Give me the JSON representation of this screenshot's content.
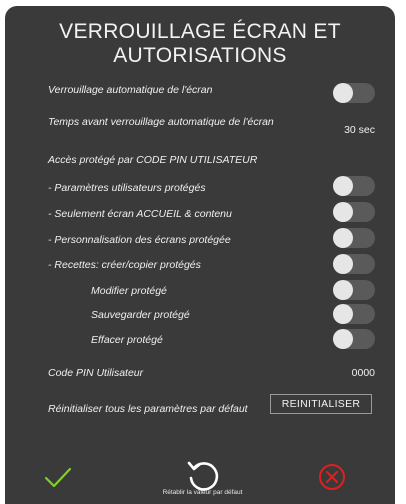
{
  "dialog": {
    "title": "VERROUILLAGE ÉCRAN ET AUTORISATIONS"
  },
  "settings": {
    "auto_lock": {
      "label": "Verrouillage automatique de l'écran",
      "enabled": false
    },
    "lock_delay": {
      "label": "Temps avant verrouillage automatique de l'écran",
      "value": "30 sec"
    },
    "pin_section": {
      "label": "Accès protégé par CODE PIN UTILISATEUR"
    },
    "user_params": {
      "label": "- Paramètres utilisateurs protégés",
      "enabled": false
    },
    "home_only": {
      "label": "- Seulement écran ACCUEIL & contenu",
      "enabled": false
    },
    "custom_screens": {
      "label": "- Personnalisation des écrans protégée",
      "enabled": false
    },
    "recipes": {
      "label": "- Recettes: créer/copier protégés",
      "enabled": false
    },
    "modify": {
      "label": "Modifier protégé",
      "enabled": false
    },
    "save": {
      "label": "Sauvegarder protégé",
      "enabled": false
    },
    "delete": {
      "label": "Effacer protégé",
      "enabled": false
    },
    "pin_code": {
      "label": "Code PIN Utilisateur",
      "value": "0000"
    },
    "reset_all": {
      "label": "Réinitialiser tous les paramètres par défaut",
      "button": "REINITIALISER"
    }
  },
  "footer": {
    "confirm_icon": "check-icon",
    "restore_icon": "undo-icon",
    "restore_label": "Rétablir la valeur par défaut",
    "cancel_icon": "close-circle-icon"
  },
  "colors": {
    "panel": "#3a3a3a",
    "confirm": "#7ed321",
    "cancel": "#e02020",
    "toggle_track": "#5a5a5a",
    "toggle_knob": "#e6e6e6"
  }
}
